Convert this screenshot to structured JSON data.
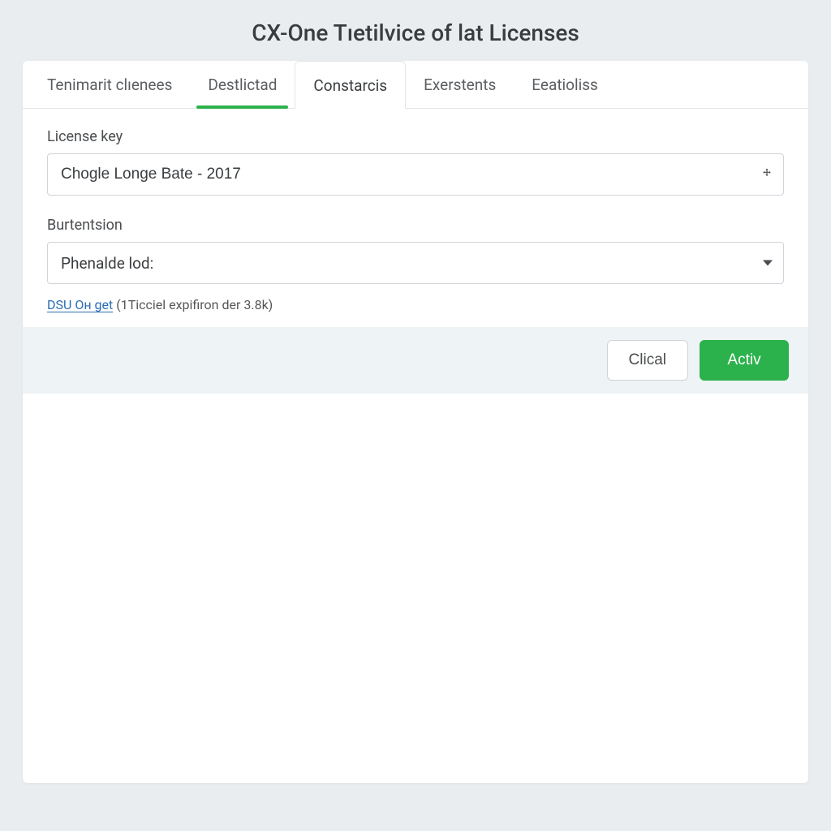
{
  "header": {
    "title": "CX-One Tıetilvice of lat Licenses"
  },
  "tabs": [
    {
      "id": "tab0",
      "label": "Tenimarit clıenees",
      "active": false,
      "underline": false
    },
    {
      "id": "tab1",
      "label": "Destlictad",
      "active": false,
      "underline": true
    },
    {
      "id": "tab2",
      "label": "Constarcis",
      "active": true,
      "underline": false
    },
    {
      "id": "tab3",
      "label": "Exerstents",
      "active": false,
      "underline": false
    },
    {
      "id": "tab4",
      "label": "Eeatioliss",
      "active": false,
      "underline": false
    }
  ],
  "form": {
    "license_key": {
      "label": "License key",
      "value": "Chogle Longe Bate - 2017"
    },
    "burtentsion": {
      "label": "Burtentsion",
      "selected": "Phenalde lod:"
    },
    "helper": {
      "link_text": "DSU Oн get",
      "rest_text": " (1Ticciel expifiron der 3.8k)"
    }
  },
  "actions": {
    "secondary_label": "Clical",
    "primary_label": "Activ"
  }
}
